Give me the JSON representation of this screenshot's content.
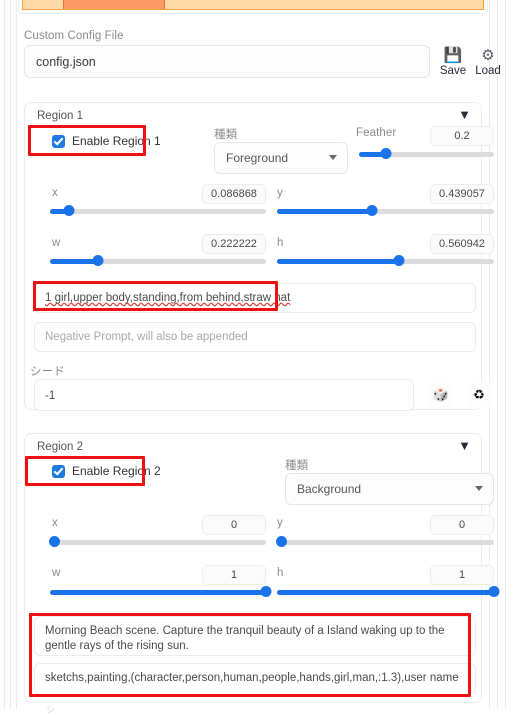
{
  "top_strip": {
    "name": "progress-tab-strip",
    "colors": {
      "light": "#ffd9a8",
      "active": "#fb9a62",
      "border": "#f5a23a"
    }
  },
  "config": {
    "label": "Custom Config File",
    "value": "config.json",
    "save_label": "Save",
    "load_label": "Load",
    "save_icon": "floppy-disk-icon",
    "load_icon": "gear-icon"
  },
  "region1": {
    "title": "Region 1",
    "caret": "▼",
    "enable_label": "Enable Region 1",
    "enabled": true,
    "type_label": "種類",
    "type_value": "Foreground",
    "feather_label": "Feather",
    "feather_value": "0.2",
    "feather_pct": 20,
    "x_label": "x",
    "x_value": "0.086868",
    "x_pct": 8.7,
    "y_label": "y",
    "y_value": "0.439057",
    "y_pct": 43.9,
    "w_label": "w",
    "w_value": "0.222222",
    "w_pct": 22.2,
    "h_label": "h",
    "h_value": "0.560942",
    "h_pct": 56.1,
    "prompt": "1 girl,upper body,standing,from behind,straw hat",
    "negative_placeholder": "Negative Prompt, will also be appended",
    "seed_label": "シード",
    "seed_value": "-1",
    "dice_icon": "dice-icon",
    "recycle_icon": "recycle-icon"
  },
  "region2": {
    "title": "Region 2",
    "caret": "▼",
    "enable_label": "Enable Region 2",
    "enabled": true,
    "type_label": "種類",
    "type_value": "Background",
    "x_label": "x",
    "x_value": "0",
    "x_pct": 0,
    "y_label": "y",
    "y_value": "0",
    "y_pct": 0,
    "w_label": "w",
    "w_value": "1",
    "w_pct": 100,
    "h_label": "h",
    "h_value": "1",
    "h_pct": 100,
    "prompt": "Morning Beach scene. Capture the tranquil beauty of a Island waking up to the gentle rays of the rising sun.",
    "negative_prompt": "sketchs,painting,(character,person,human,people,hands,girl,man,:1.3),user name"
  },
  "annotations": {
    "color": "#ee1111",
    "boxes": [
      "enable-region-1-highlight",
      "region1-prompt-highlight",
      "enable-region-2-highlight",
      "region2-prompts-highlight"
    ]
  }
}
